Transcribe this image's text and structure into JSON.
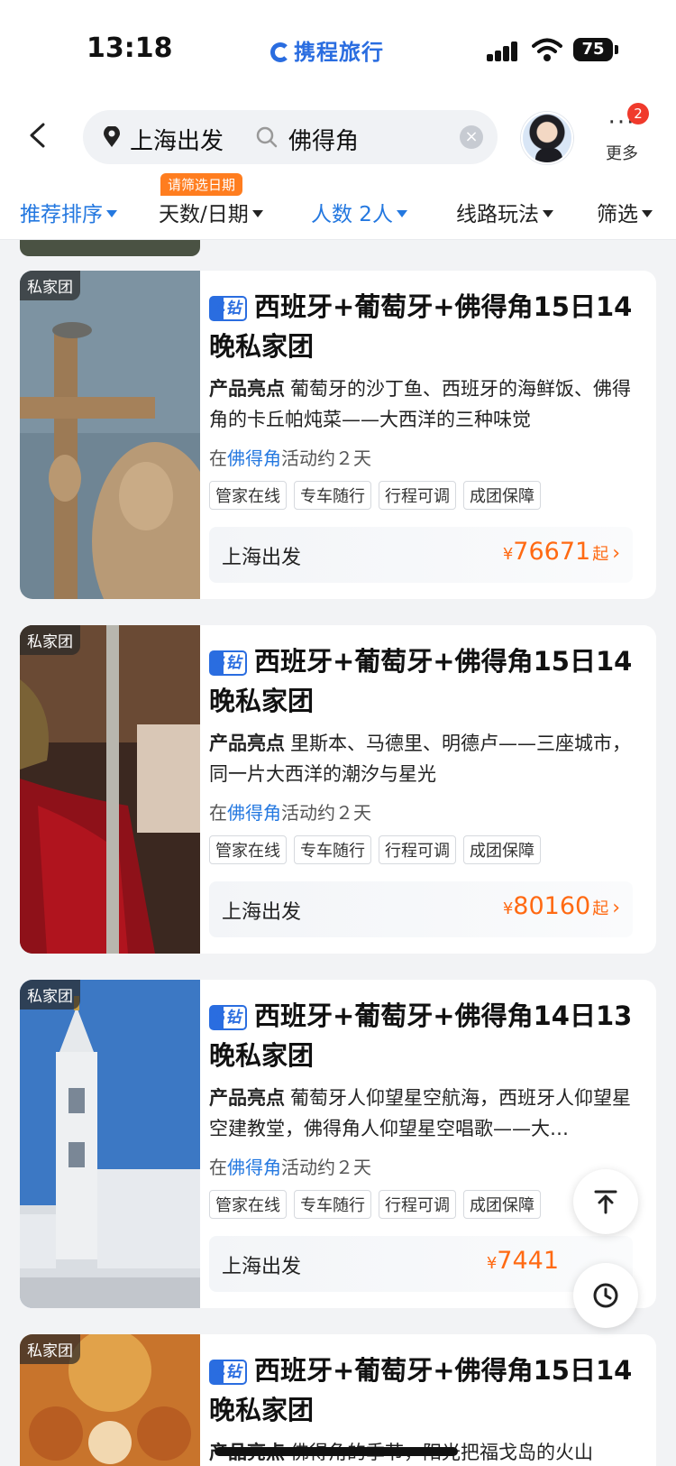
{
  "status_bar": {
    "time": "13:18",
    "brand": "携程旅行",
    "battery": "75"
  },
  "header": {
    "departure": "上海出发",
    "search_query": "佛得角",
    "more_label": "更多",
    "more_badge": "2",
    "icons": [
      "back-chevron",
      "location-pin",
      "search",
      "clear",
      "avatar",
      "more-dots"
    ]
  },
  "filters": {
    "hint": "请筛选日期",
    "items": [
      {
        "label": "推荐排序",
        "active": true
      },
      {
        "label": "天数/日期",
        "active": false
      },
      {
        "label": "人数 2人",
        "active": true
      },
      {
        "label": "线路玩法",
        "active": false
      },
      {
        "label": "筛选",
        "active": false
      }
    ]
  },
  "colors": {
    "accent": "#2478e0",
    "price": "#ff6a13",
    "hint": "#ff7d1f",
    "badge": "#f03a2c"
  },
  "products": [
    {
      "tag": "私家团",
      "stars": "4钻",
      "title": "西班牙+葡萄牙+佛得角15日14晚私家团",
      "highlight_label": "产品亮点",
      "highlight": "葡萄牙的沙丁鱼、西班牙的海鲜饭、佛得角的卡丘帕炖菜——大西洋的三种味觉",
      "activity_pre": "在",
      "activity_dest": "佛得角",
      "activity_post": "活动约２天",
      "chips": [
        "管家在线",
        "专车随行",
        "行程可调",
        "成团保障"
      ],
      "departure": "上海出发",
      "currency": "¥",
      "price": "76671",
      "price_suffix": "起"
    },
    {
      "tag": "私家团",
      "stars": "5钻",
      "title": "西班牙+葡萄牙+佛得角15日14晚私家团",
      "highlight_label": "产品亮点",
      "highlight": "里斯本、马德里、明德卢——三座城市，同一片大西洋的潮汐与星光",
      "activity_pre": "在",
      "activity_dest": "佛得角",
      "activity_post": "活动约２天",
      "chips": [
        "管家在线",
        "专车随行",
        "行程可调",
        "成团保障"
      ],
      "departure": "上海出发",
      "currency": "¥",
      "price": "80160",
      "price_suffix": "起"
    },
    {
      "tag": "私家团",
      "stars": "5钻",
      "title": "西班牙+葡萄牙+佛得角14日13晚私家团",
      "highlight_label": "产品亮点",
      "highlight": "葡萄牙人仰望星空航海，西班牙人仰望星空建教堂，佛得角人仰望星空唱歌——大…",
      "activity_pre": "在",
      "activity_dest": "佛得角",
      "activity_post": "活动约２天",
      "chips": [
        "管家在线",
        "专车随行",
        "行程可调",
        "成团保障"
      ],
      "departure": "上海出发",
      "currency": "¥",
      "price": "7441",
      "price_suffix": ""
    },
    {
      "tag": "私家团",
      "stars": "4钻",
      "title": "西班牙+葡萄牙+佛得角15日14晚私家团",
      "highlight_label": "产品亮点",
      "highlight": "佛得角的季节，阳光把福戈岛的火山"
    }
  ],
  "fab_icons": [
    "back-to-top-icon",
    "history-clock-icon"
  ]
}
